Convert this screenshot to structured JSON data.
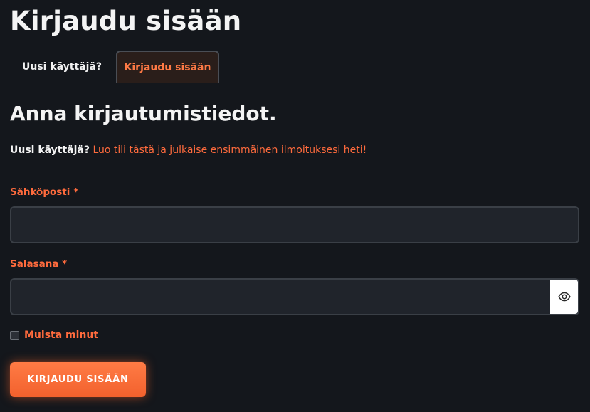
{
  "page": {
    "title": "Kirjaudu sisään"
  },
  "tabs": [
    {
      "label": "Uusi käyttäjä?",
      "active": false
    },
    {
      "label": "Kirjaudu sisään",
      "active": true
    }
  ],
  "form": {
    "heading": "Anna kirjautumistiedot.",
    "signup_question": "Uusi käyttäjä?",
    "signup_link": "Luo tili tästä ja julkaise ensimmäinen ilmoituksesi heti!",
    "email_label": "Sähköposti *",
    "email_value": "",
    "password_label": "Salasana *",
    "password_value": "",
    "show_password_icon": "eye-icon",
    "remember_label": "Muista minut",
    "remember_checked": false,
    "submit_label": "KIRJAUDU SISÄÄN"
  },
  "colors": {
    "background": "#14171c",
    "accent": "#ff6b3d",
    "input_background": "#20242b"
  }
}
